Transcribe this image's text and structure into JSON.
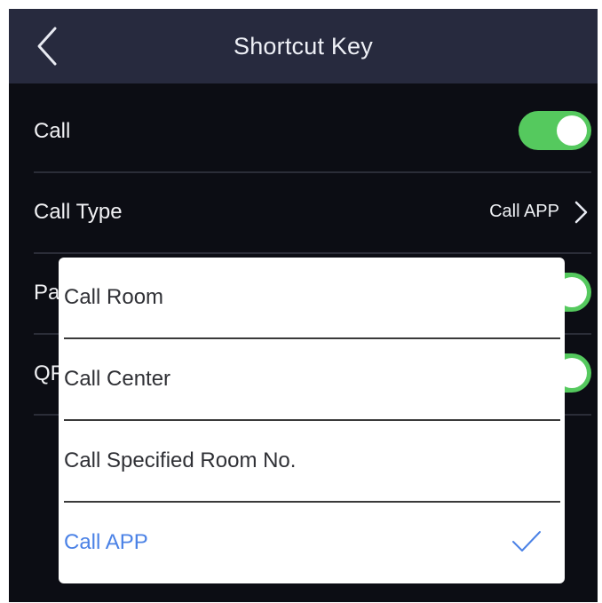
{
  "header": {
    "title": "Shortcut Key",
    "back_icon": "chevron-left-icon"
  },
  "settings": {
    "call": {
      "label": "Call",
      "enabled": true
    },
    "call_type": {
      "label": "Call Type",
      "value": "Call APP",
      "icon": "chevron-right-icon"
    },
    "row3": {
      "label_visible": "Pa",
      "enabled": true
    },
    "row4": {
      "label_visible": "QF",
      "enabled": true
    }
  },
  "dropdown": {
    "options": [
      {
        "label": "Call Room",
        "selected": false
      },
      {
        "label": "Call Center",
        "selected": false
      },
      {
        "label": "Call Specified Room No.",
        "selected": false
      },
      {
        "label": "Call APP",
        "selected": true
      }
    ],
    "selected_icon": "checkmark-icon"
  },
  "colors": {
    "header_bg": "#272a3e",
    "screen_bg": "#0c0d14",
    "toggle_on": "#55c95e",
    "selected_text": "#4b82e6"
  }
}
